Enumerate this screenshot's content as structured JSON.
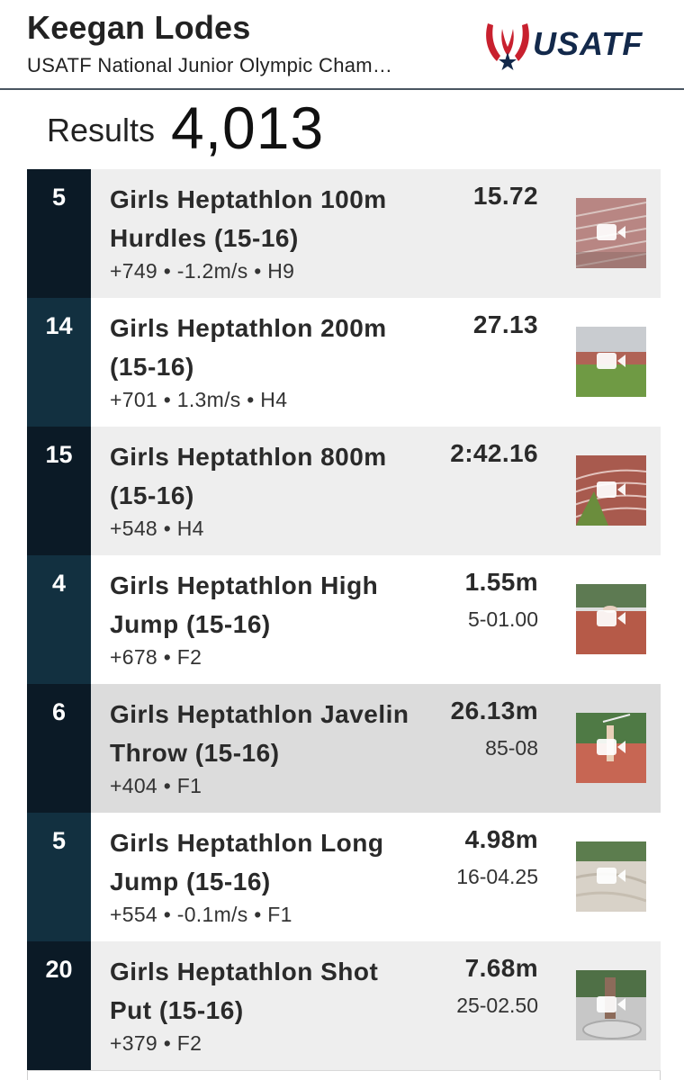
{
  "header": {
    "athlete_name": "Keegan Lodes",
    "meet_name": "USATF National Junior Olympic Cham…",
    "logo_text": "USATF"
  },
  "results": {
    "label": "Results",
    "count": "4,013"
  },
  "colors": {
    "navy_dark": "#0b1a26",
    "navy_teal": "#123040",
    "row_gray": "#eeeeee",
    "row_highlight": "#dcdcdc",
    "logo_red": "#c8202e",
    "logo_navy": "#13294b"
  },
  "rows": [
    {
      "place": "5",
      "event": "Girls Heptathlon 100m Hurdles (15-16)",
      "mark": "15.72",
      "conversion": "",
      "meta": "+749 • -1.2m/s • H9",
      "thumb_icon": "video-camera-icon"
    },
    {
      "place": "14",
      "event": "Girls Heptathlon 200m (15-16)",
      "mark": "27.13",
      "conversion": "",
      "meta": "+701 • 1.3m/s • H4",
      "thumb_icon": "video-camera-icon"
    },
    {
      "place": "15",
      "event": "Girls Heptathlon 800m (15-16)",
      "mark": "2:42.16",
      "conversion": "",
      "meta": "+548 • H4",
      "thumb_icon": "video-camera-icon"
    },
    {
      "place": "4",
      "event": "Girls Heptathlon High Jump (15-16)",
      "mark": "1.55m",
      "conversion": "5-01.00",
      "meta": "+678 • F2",
      "thumb_icon": "video-camera-icon"
    },
    {
      "place": "6",
      "event": "Girls Heptathlon Javelin Throw (15-16)",
      "mark": "26.13m",
      "conversion": "85-08",
      "meta": "+404 • F1",
      "thumb_icon": "video-camera-icon"
    },
    {
      "place": "5",
      "event": "Girls Heptathlon Long Jump (15-16)",
      "mark": "4.98m",
      "conversion": "16-04.25",
      "meta": "+554 • -0.1m/s • F1",
      "thumb_icon": "video-camera-icon"
    },
    {
      "place": "20",
      "event": "Girls Heptathlon Shot Put (15-16)",
      "mark": "7.68m",
      "conversion": "25-02.50",
      "meta": "+379 • F2",
      "thumb_icon": "video-camera-icon"
    }
  ]
}
